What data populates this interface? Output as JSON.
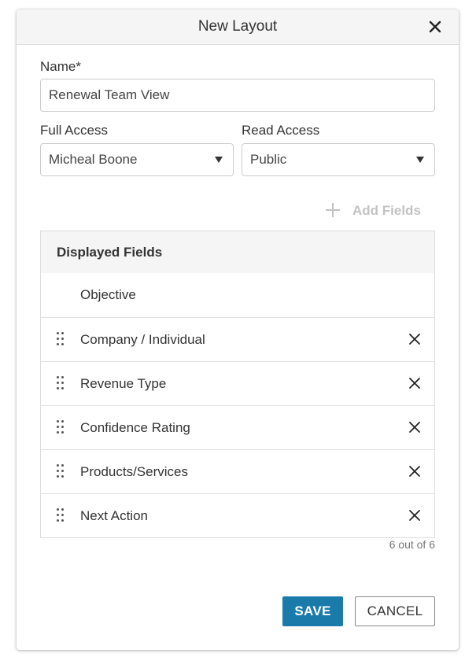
{
  "dialog": {
    "title": "New Layout",
    "close_icon": "close-icon"
  },
  "form": {
    "name_label": "Name*",
    "name_value": "Renewal Team View",
    "full_access_label": "Full Access",
    "full_access_value": "Micheal Boone",
    "read_access_label": "Read Access",
    "read_access_value": "Public"
  },
  "add_fields": {
    "label": "Add Fields",
    "icon": "plus-icon"
  },
  "displayed_fields": {
    "header": "Displayed Fields",
    "items": [
      {
        "label": "Objective",
        "locked": true
      },
      {
        "label": "Company / Individual",
        "locked": false
      },
      {
        "label": "Revenue Type",
        "locked": false
      },
      {
        "label": "Confidence Rating",
        "locked": false
      },
      {
        "label": "Products/Services",
        "locked": false
      },
      {
        "label": "Next Action",
        "locked": false
      }
    ],
    "count_text": "6 out of 6"
  },
  "footer": {
    "save_label": "SAVE",
    "cancel_label": "CANCEL"
  },
  "colors": {
    "primary": "#1a7bab",
    "header_bg": "#f5f5f5",
    "disabled_text": "#c2c2c2"
  }
}
